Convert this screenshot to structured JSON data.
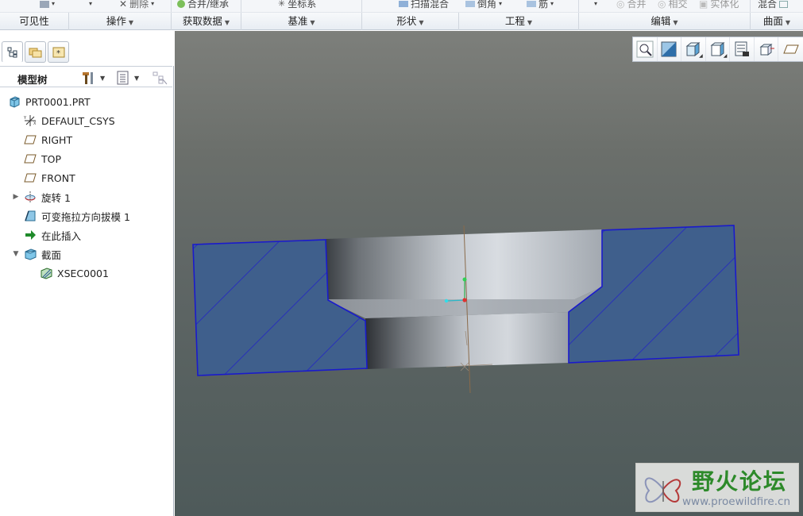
{
  "ribbon": {
    "top_items": [
      {
        "label": "删除",
        "icon": "delete-x-icon"
      },
      {
        "label": "合并/继承",
        "icon": "merge-inherit-icon"
      },
      {
        "label": "坐标系",
        "icon": "coordinate-system-icon"
      },
      {
        "label": "扫描混合",
        "icon": "swept-blend-icon"
      },
      {
        "label": "倒角",
        "icon": "chamfer-icon"
      },
      {
        "label": "筋",
        "icon": "rib-icon"
      },
      {
        "label": "合并",
        "icon": "merge-icon"
      },
      {
        "label": "相交",
        "icon": "intersect-icon"
      },
      {
        "label": "实体化",
        "icon": "solidify-icon"
      },
      {
        "label": "混合",
        "icon": "blend-icon"
      }
    ],
    "groups": [
      {
        "label": "可见性",
        "has_menu": false
      },
      {
        "label": "操作",
        "has_menu": true
      },
      {
        "label": "获取数据",
        "has_menu": true
      },
      {
        "label": "基准",
        "has_menu": true
      },
      {
        "label": "形状",
        "has_menu": true
      },
      {
        "label": "工程",
        "has_menu": true
      },
      {
        "label": "编辑",
        "has_menu": true
      },
      {
        "label": "曲面",
        "has_menu": true
      }
    ]
  },
  "left_panel": {
    "tabs": [
      {
        "name": "model-tree-tab",
        "icon": "tree-structure-icon",
        "active": true
      },
      {
        "name": "folder-browser-tab",
        "icon": "folder-icon",
        "active": false
      },
      {
        "name": "favorites-tab",
        "icon": "favorites-star-icon",
        "active": false
      }
    ],
    "tree_title": "模型树",
    "tree_items": [
      {
        "label": "PRT0001.PRT",
        "icon": "part-icon",
        "level": 0,
        "expander": ""
      },
      {
        "label": "DEFAULT_CSYS",
        "icon": "coordinate-system-icon",
        "level": 1,
        "expander": ""
      },
      {
        "label": "RIGHT",
        "icon": "datum-plane-icon",
        "level": 1,
        "expander": ""
      },
      {
        "label": "TOP",
        "icon": "datum-plane-icon",
        "level": 1,
        "expander": ""
      },
      {
        "label": "FRONT",
        "icon": "datum-plane-icon",
        "level": 1,
        "expander": ""
      },
      {
        "label": "旋转 1",
        "icon": "revolve-icon",
        "level": 1,
        "expander": "collapsed"
      },
      {
        "label": "可变拖拉方向拔模 1",
        "icon": "variable-draft-icon",
        "level": 1,
        "expander": ""
      },
      {
        "label": "在此插入",
        "icon": "insert-here-arrow-icon",
        "level": 1,
        "expander": ""
      },
      {
        "label": "截面",
        "icon": "section-icon",
        "level": 1,
        "expander": "expanded"
      },
      {
        "label": "XSEC0001",
        "icon": "xsec-icon",
        "level": 2,
        "expander": ""
      }
    ]
  },
  "view_toolbar": [
    {
      "name": "refit-button",
      "icon": "zoom-magnifier-icon"
    },
    {
      "name": "repaint-button",
      "icon": "repaint-icon"
    },
    {
      "name": "display-style-button",
      "icon": "shaded-cube-icon"
    },
    {
      "name": "saved-orientations-button",
      "icon": "saved-view-icon"
    },
    {
      "name": "view-manager-button",
      "icon": "view-manager-icon"
    },
    {
      "name": "perspective-button",
      "icon": "perspective-icon"
    },
    {
      "name": "datum-display-button",
      "icon": "datum-display-icon"
    }
  ],
  "watermark": {
    "title": "野火论坛",
    "url": "www.proewildfire.cn"
  },
  "colors": {
    "section_fill": "#3f5f8c",
    "section_edge": "#1a1acc",
    "viewport_top": "#7d7f7b",
    "viewport_bottom": "#4e5a5a",
    "watermark_green": "#2d8a2a"
  }
}
